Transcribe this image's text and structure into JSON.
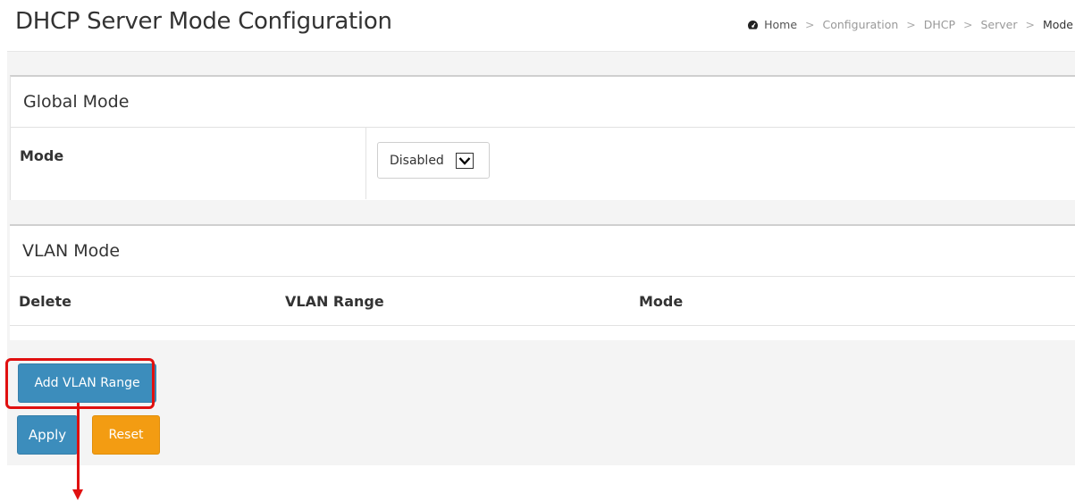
{
  "header": {
    "title": "DHCP Server Mode Configuration",
    "breadcrumb": {
      "home": "Home",
      "items": [
        "Configuration",
        "DHCP",
        "Server"
      ],
      "current": "Mode",
      "separator": ">"
    }
  },
  "global_mode": {
    "heading": "Global Mode",
    "mode_label": "Mode",
    "mode_value": "Disabled"
  },
  "vlan_mode": {
    "heading": "VLAN Mode",
    "columns": [
      "Delete",
      "VLAN Range",
      "Mode"
    ]
  },
  "buttons": {
    "add_vlan_range": "Add VLAN Range",
    "apply": "Apply",
    "reset": "Reset"
  },
  "colors": {
    "primary": "#3c8dbc",
    "warning": "#f39c12",
    "annotation": "#e01010"
  }
}
